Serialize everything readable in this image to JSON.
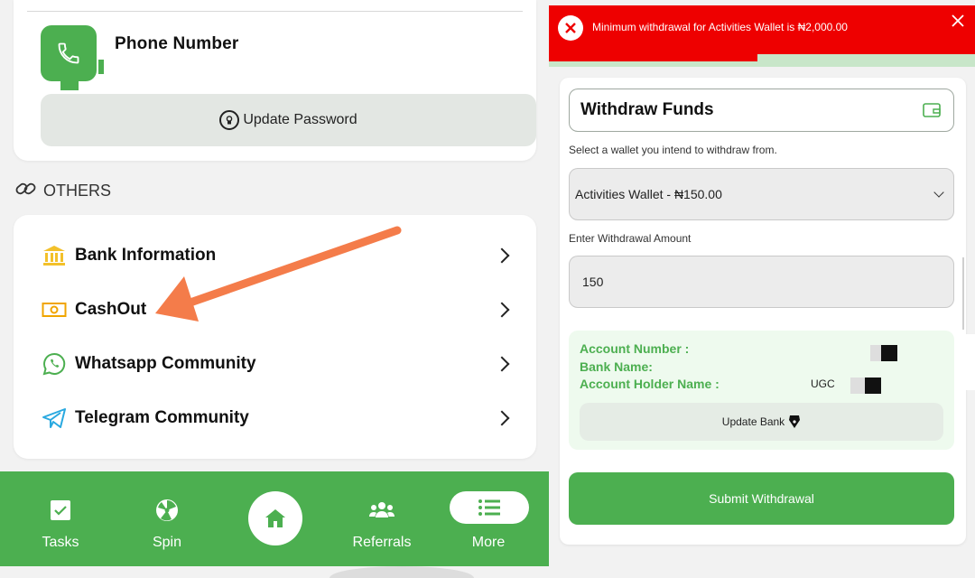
{
  "left": {
    "profile": {
      "phone_label": "Phone Number",
      "update_password_label": "Update Password"
    },
    "others_heading": "OTHERS",
    "menu": [
      {
        "label": "Bank Information",
        "icon": "bank-icon"
      },
      {
        "label": "CashOut",
        "icon": "cash-icon"
      },
      {
        "label": "Whatsapp Community",
        "icon": "whatsapp-icon"
      },
      {
        "label": "Telegram Community",
        "icon": "telegram-icon"
      }
    ],
    "nav": {
      "tasks": "Tasks",
      "spin": "Spin",
      "referrals": "Referrals",
      "more": "More"
    },
    "colors": {
      "brand_green": "#4caf50",
      "arrow": "#f47c4a",
      "bank_icon": "#f3c12b"
    }
  },
  "right": {
    "toast": {
      "message": "Minimum withdrawal for Activities Wallet is ₦2,000.00",
      "progress": 0.49,
      "color": "#ee0000"
    },
    "form": {
      "title": "Withdraw Funds",
      "wallet_prompt": "Select a wallet you intend to withdraw from.",
      "wallet_selected": "Activities Wallet - ₦150.00",
      "amount_label": "Enter Withdrawal Amount",
      "amount_value": "150",
      "account_number_label": "Account Number :",
      "bank_name_label": "Bank Name:",
      "account_holder_label": "Account Holder Name :",
      "account_holder_value": "UGC",
      "update_bank_label": "Update Bank",
      "submit_label": "Submit Withdrawal"
    }
  }
}
